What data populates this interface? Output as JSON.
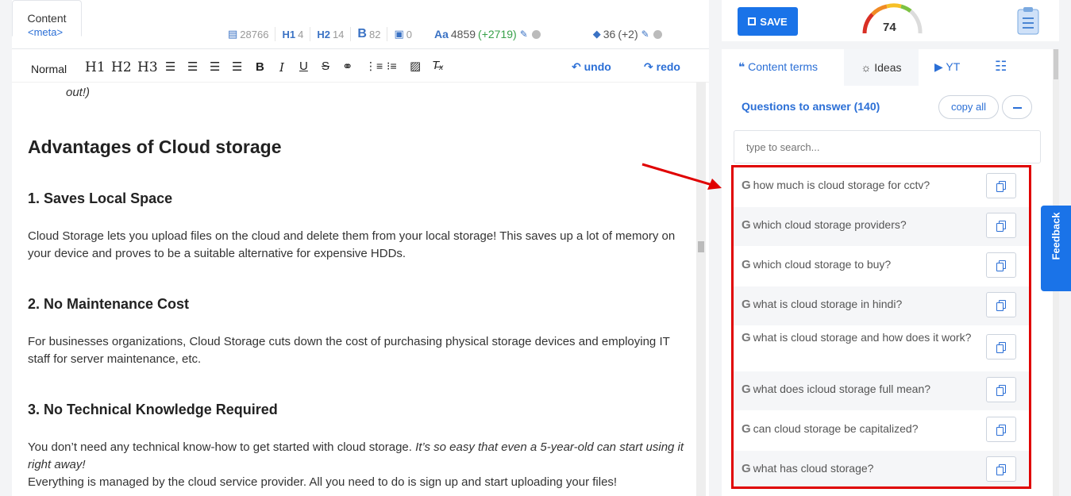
{
  "editor_tabs": {
    "meta": "<meta>",
    "content": "Content"
  },
  "stats": {
    "images_count": "28766",
    "h1_label": "H1",
    "h1_count": "4",
    "h2_label": "H2",
    "h2_count": "14",
    "b_label": "B",
    "b_count": "82",
    "img_count": "0",
    "words_label": "Aa",
    "words": "4859",
    "words_delta": "(+2719)",
    "grade": "36",
    "grade_delta": "(+2)"
  },
  "toolbar": {
    "normal": "Normal",
    "h1": "H1",
    "h2": "H2",
    "h3": "H3",
    "undo": "undo",
    "redo": "redo"
  },
  "editor": {
    "fragment": "out!)",
    "heading": "Advantages of Cloud storage",
    "sections": [
      {
        "title": "1. Saves Local Space",
        "body": "Cloud Storage lets you upload files on the cloud and delete them from your local storage! This saves up a lot of memory on your device and proves to be a suitable alternative for expensive HDDs."
      },
      {
        "title": "2. No Maintenance Cost",
        "body": "For businesses organizations, Cloud Storage cuts down the cost of purchasing physical storage devices and employing IT staff for server maintenance, etc."
      },
      {
        "title": "3. No Technical Knowledge Required",
        "body_plain": "You don’t need any technical know-how to get started with cloud storage. ",
        "body_italic": "It’s so easy that even a 5-year-old can start using it right away!",
        "body2": "Everything is managed by the cloud service provider. All you need to do is sign up and start uploading your files!"
      }
    ]
  },
  "top": {
    "save": "SAVE",
    "score": "74"
  },
  "panel_tabs": {
    "terms": "Content terms",
    "ideas": "Ideas",
    "yt": "YT"
  },
  "questions": {
    "header": "Questions to answer (140)",
    "copy_all": "copy all",
    "search_placeholder": "type to search...",
    "items": [
      "how much is cloud storage for cctv?",
      "which cloud storage providers?",
      "which cloud storage to buy?",
      "what is cloud storage in hindi?",
      "what is cloud storage and how does it work?",
      "what does icloud storage full mean?",
      "can cloud storage be capitalized?",
      "what has cloud storage?"
    ]
  },
  "feedback": "Feedback",
  "colors": {
    "accent": "#1a73e8",
    "highlight": "#e00000",
    "positive": "#38a14a"
  }
}
